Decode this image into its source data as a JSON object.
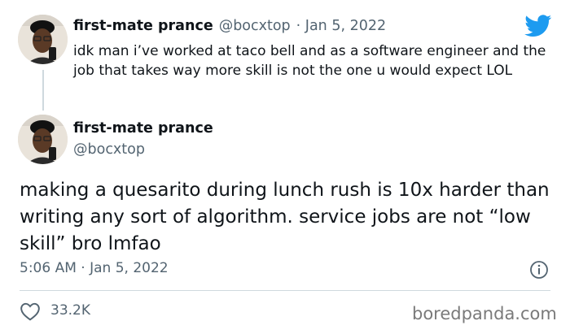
{
  "reply": {
    "display_name": "first-mate prance",
    "handle": "@bocxtop",
    "date": "· Jan 5, 2022",
    "text": "idk man i’ve worked at taco bell and as a software engineer and the job that takes way more skill is not the one u would expect LOL"
  },
  "main": {
    "display_name": "first-mate prance",
    "handle": "@bocxtop",
    "text": "making a quesarito during lunch rush is 10x harder than writing any sort of algorithm. service jobs are not “low skill” bro lmfao",
    "timestamp": "5:06 AM · Jan 5, 2022",
    "likes": "33.2K"
  },
  "watermark": "boredpanda.com",
  "colors": {
    "twitter_blue": "#1d9bf0",
    "muted": "#536471",
    "divider": "#cfd9de"
  },
  "icons": {
    "brand": "twitter-bird-icon",
    "info": "info-icon",
    "like": "heart-icon"
  }
}
